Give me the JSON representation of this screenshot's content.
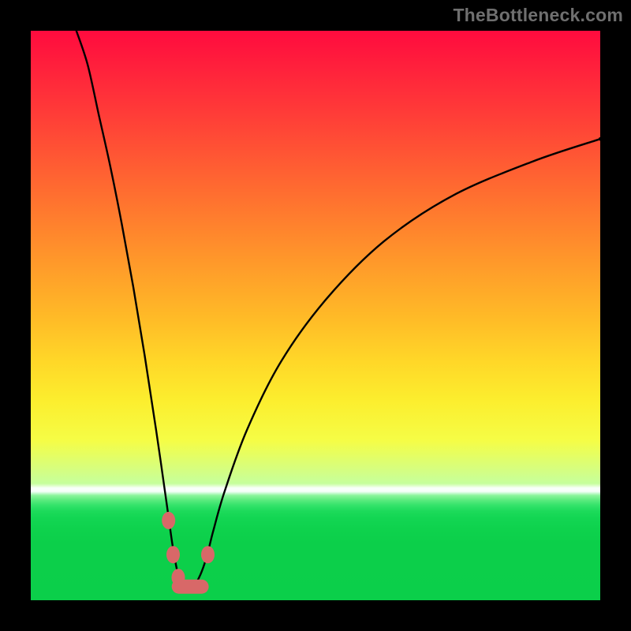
{
  "attribution": "TheBottleneck.com",
  "chart_data": {
    "type": "line",
    "title": "",
    "xlabel": "",
    "ylabel": "",
    "xlim": [
      0,
      100
    ],
    "ylim": [
      0,
      100
    ],
    "grid": false,
    "series": [
      {
        "name": "bottleneck-curve",
        "x": [
          8,
          10,
          12,
          14,
          16,
          18,
          20,
          22,
          24,
          25,
          26,
          27,
          28,
          29,
          30,
          31,
          32,
          34,
          38,
          44,
          52,
          62,
          74,
          88,
          100
        ],
        "y": [
          100,
          94,
          85,
          76,
          66,
          55,
          43,
          30,
          16,
          9,
          4,
          2,
          2,
          3,
          5,
          8,
          12,
          19,
          30,
          42,
          53,
          63,
          71,
          77,
          81
        ]
      }
    ],
    "markers": [
      {
        "name": "left-marker-1",
        "x": 24.2,
        "y": 14,
        "color": "#d86868"
      },
      {
        "name": "left-marker-2",
        "x": 25.0,
        "y": 8,
        "color": "#d86868"
      },
      {
        "name": "left-marker-3",
        "x": 25.9,
        "y": 4,
        "color": "#d86868"
      },
      {
        "name": "right-marker-1",
        "x": 31.1,
        "y": 8,
        "color": "#d86868"
      },
      {
        "name": "far-right-marker",
        "x": 100,
        "y": 81,
        "color": "#000000"
      }
    ],
    "marker_bar": {
      "name": "trough-bar",
      "x_start": 26.0,
      "x_end": 30.0,
      "y": 2.4,
      "color": "#d86868"
    },
    "gradient_stops": [
      {
        "pct": 0,
        "color": "#ff0b3e"
      },
      {
        "pct": 50,
        "color": "#ffb927"
      },
      {
        "pct": 72,
        "color": "#f5fd46"
      },
      {
        "pct": 80,
        "color": "#c6ff9c"
      },
      {
        "pct": 85,
        "color": "#1ddb5b"
      },
      {
        "pct": 100,
        "color": "#0bcf4a"
      }
    ]
  }
}
